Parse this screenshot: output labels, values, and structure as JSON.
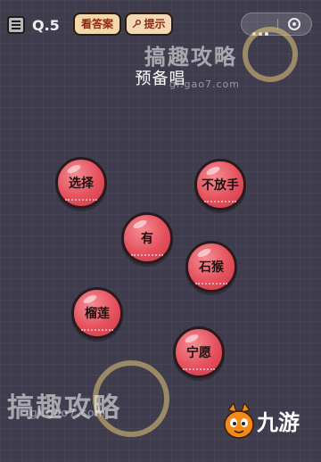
{
  "header": {
    "level": "Q.5",
    "answer_button": "看答案",
    "hint_button": "提示"
  },
  "title": "预备唱",
  "bubbles": [
    "选择",
    "不放手",
    "有",
    "石猴",
    "榴莲",
    "宁愿"
  ],
  "watermark": {
    "text": "搞趣攻略",
    "url": "gl.gao7.com"
  },
  "logo": {
    "brand": "九游"
  },
  "colors": {
    "background": "#3f3d4d",
    "bubble_fill": "#e5505c",
    "pill_fill": "#f3d7a8"
  }
}
